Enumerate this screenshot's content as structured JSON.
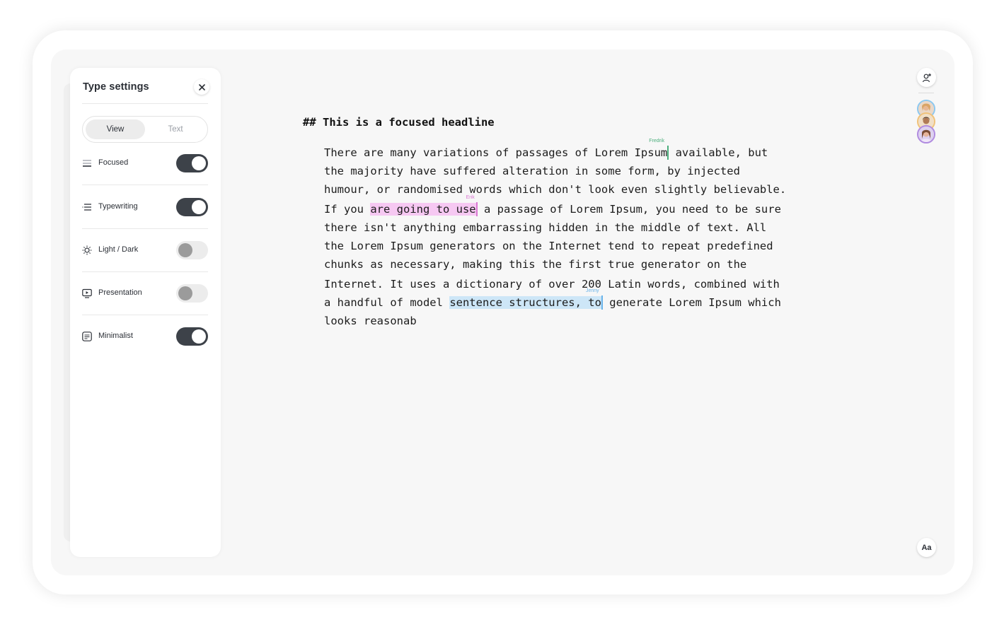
{
  "panel": {
    "title": "Type settings",
    "tabs": [
      {
        "label": "View",
        "selected": true
      },
      {
        "label": "Text",
        "selected": false
      }
    ],
    "settings": [
      {
        "label": "Focused",
        "icon": "focused-icon",
        "on": true
      },
      {
        "label": "Typewriting",
        "icon": "typewriting-icon",
        "on": true
      },
      {
        "label": "Light / Dark",
        "icon": "sun-icon",
        "on": false
      },
      {
        "label": "Presentation",
        "icon": "presentation-icon",
        "on": false
      },
      {
        "label": "Minimalist",
        "icon": "minimalist-icon",
        "on": true
      }
    ]
  },
  "editor": {
    "headline_marker": "##",
    "headline": "This is a focused headline",
    "lines": [
      "There are many variations of passages of Lorem Ipsum",
      " available, but",
      "the majority have suffered alteration in some form, by injected",
      "humour, or randomised words which don't look even slightly believable.",
      "If you ",
      "are going to use",
      " a passage of Lorem Ipsum, you need to be sure",
      "there isn't anything embarrassing hidden in the middle of text. All",
      "the Lorem Ipsum generators on the Internet tend to repeat predefined",
      "chunks as necessary, making this the first true generator on the",
      "Internet. It uses a dictionary of over 200 Latin words, combined with",
      "a handful of model ",
      "sentence structures, to",
      " generate Lorem Ipsum which",
      "looks reasonab"
    ],
    "collaborator_cursors": [
      {
        "name": "Fredrik",
        "color": "#4caf7d"
      },
      {
        "name": "Erik",
        "color": "#d977d2"
      },
      {
        "name": "Jenny",
        "color": "#6ab4ea"
      }
    ]
  },
  "sidebar_right": {
    "add_collaborator_icon": "add-user-icon",
    "avatars": [
      {
        "name": "avatar-1",
        "ring": "#8cc8f0"
      },
      {
        "name": "avatar-2",
        "ring": "#f0c27a"
      },
      {
        "name": "avatar-3",
        "ring": "#b08be0"
      }
    ],
    "font_button_label": "Aa"
  }
}
